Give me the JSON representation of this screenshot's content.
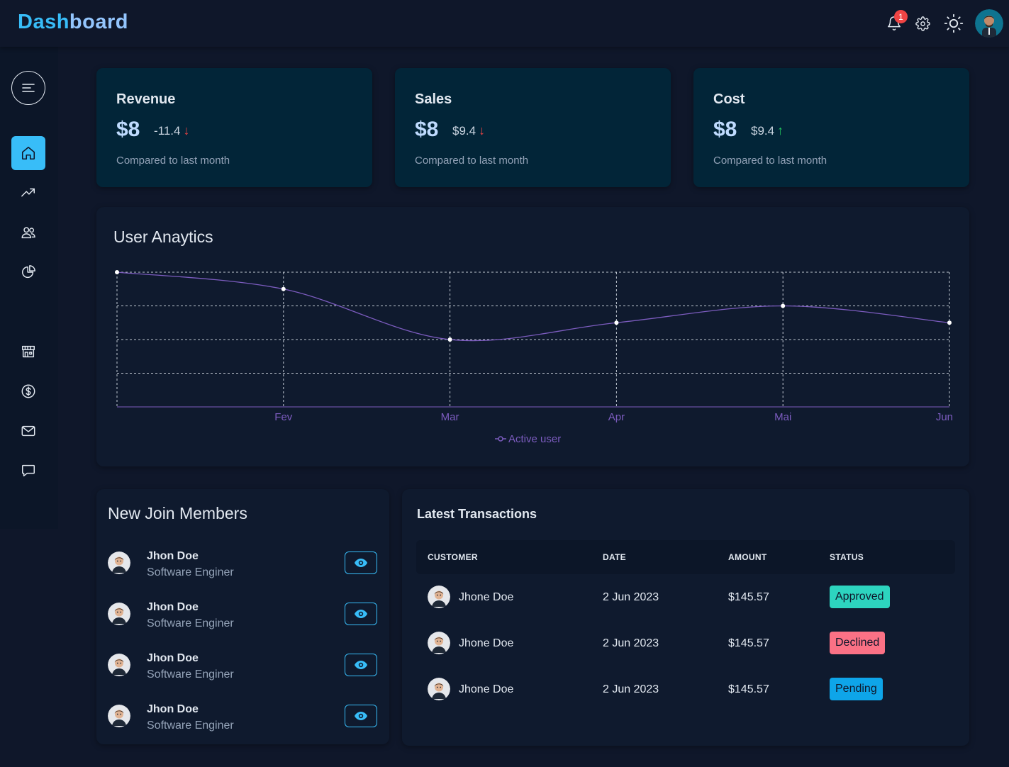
{
  "header": {
    "brand_part1": "Dash",
    "brand_part2": "board",
    "notification_count": "1"
  },
  "sidebar": {
    "items": [
      {
        "icon": "home-icon",
        "active": true
      },
      {
        "icon": "trending-icon"
      },
      {
        "icon": "users-icon"
      },
      {
        "icon": "pie-chart-icon"
      },
      {
        "icon": "store-icon"
      },
      {
        "icon": "dollar-icon"
      },
      {
        "icon": "mail-icon"
      },
      {
        "icon": "chat-icon"
      }
    ]
  },
  "stats": [
    {
      "title": "Revenue",
      "value": "$8",
      "change": "-11.4",
      "direction": "down",
      "compare": "Compared to last month"
    },
    {
      "title": "Sales",
      "value": "$8",
      "change": "$9.4",
      "direction": "down",
      "compare": "Compared to last month"
    },
    {
      "title": "Cost",
      "value": "$8",
      "change": "$9.4",
      "direction": "up",
      "compare": "Compared to last month"
    }
  ],
  "analytics": {
    "title": "User Anaytics",
    "legend": "Active user"
  },
  "chart_data": {
    "type": "line",
    "categories": [
      "",
      "Fev",
      "Mar",
      "Apr",
      "Mai",
      "Jun"
    ],
    "series": [
      {
        "name": "Active user",
        "values": [
          4,
          3.5,
          2,
          2.5,
          3,
          2.5
        ]
      }
    ],
    "ylim": [
      0,
      4
    ],
    "grid": true,
    "legend_position": "bottom",
    "color": "#7c5cbf"
  },
  "members": {
    "title": "New Join Members",
    "items": [
      {
        "name": "Jhon Doe",
        "role": "Software Enginer"
      },
      {
        "name": "Jhon Doe",
        "role": "Software Enginer"
      },
      {
        "name": "Jhon Doe",
        "role": "Software Enginer"
      },
      {
        "name": "Jhon Doe",
        "role": "Software Enginer"
      }
    ]
  },
  "transactions": {
    "title": "Latest Transactions",
    "columns": [
      "CUSTOMER",
      "DATE",
      "AMOUNT",
      "STATUS"
    ],
    "rows": [
      {
        "customer": "Jhone Doe",
        "date": "2 Jun 2023",
        "amount": "$145.57",
        "status": "Approved",
        "status_color": "#2dd4bf"
      },
      {
        "customer": "Jhone Doe",
        "date": "2 Jun 2023",
        "amount": "$145.57",
        "status": "Declined",
        "status_color": "#fb7185"
      },
      {
        "customer": "Jhone Doe",
        "date": "2 Jun 2023",
        "amount": "$145.57",
        "status": "Pending",
        "status_color": "#0ea5e9"
      }
    ]
  }
}
